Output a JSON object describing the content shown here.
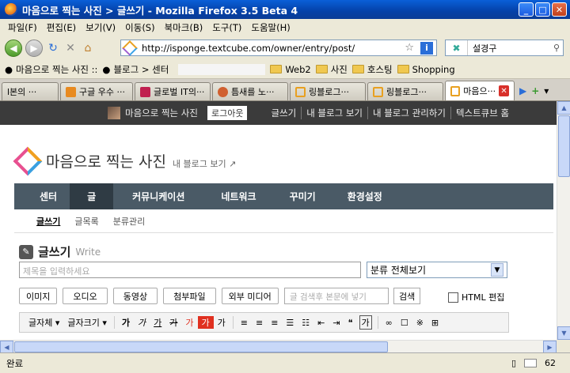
{
  "window": {
    "title": "마음으로 찍는 사진 > 글쓰기 - Mozilla Firefox 3.5 Beta 4",
    "minimize": "_",
    "maximize": "□",
    "close": "✕"
  },
  "menu": [
    "파일(F)",
    "편집(E)",
    "보기(V)",
    "이동(S)",
    "북마크(B)",
    "도구(T)",
    "도움말(H)"
  ],
  "nav": {
    "url": "http://isponge.textcube.com/owner/entry/post/",
    "search_value": "설경구"
  },
  "bookmarks": {
    "item1": "마음으로 찍는 사진 ::",
    "item2": "블로그 > 센터",
    "folders": [
      "Web2",
      "사진",
      "호스팅",
      "Shopping"
    ]
  },
  "tabs": [
    "l본의 ···",
    "구글 우수 ···",
    "글로벌 IT의···",
    "틈새를 노···",
    "링블로그···",
    "링블로그···",
    "마음으···"
  ],
  "blog": {
    "name": "마음으로 찍는 사진",
    "logout": "로그아웃",
    "toplinks": [
      "글쓰기",
      "내 블로그 보기",
      "내 블로그 관리하기",
      "텍스트큐브 홈"
    ],
    "logo_title": "마음으로 찍는 사진",
    "logo_sub": "내 블로그 보기 ↗",
    "mainnav": [
      "센터",
      "글",
      "커뮤니케이션",
      "네트워크",
      "꾸미기",
      "환경설정"
    ],
    "subnav": [
      "글쓰기",
      "글목록",
      "분류관리"
    ],
    "heading": "글쓰기",
    "heading_sub": "Write",
    "title_placeholder": "제목을 입력하세요",
    "category": "분류 전체보기",
    "buttons": [
      "이미지",
      "오디오",
      "동영상",
      "첨부파일",
      "외부 미디어"
    ],
    "search_placeholder": "글 검색후 본문에 넣기",
    "search_btn": "검색",
    "html_edit": "HTML 편집",
    "editor_tools": [
      "글자체 ▾",
      "글자크기 ▾",
      "가",
      "가",
      "가",
      "가",
      "가",
      "가",
      "가"
    ]
  },
  "status": {
    "text": "완료",
    "count": "62"
  }
}
